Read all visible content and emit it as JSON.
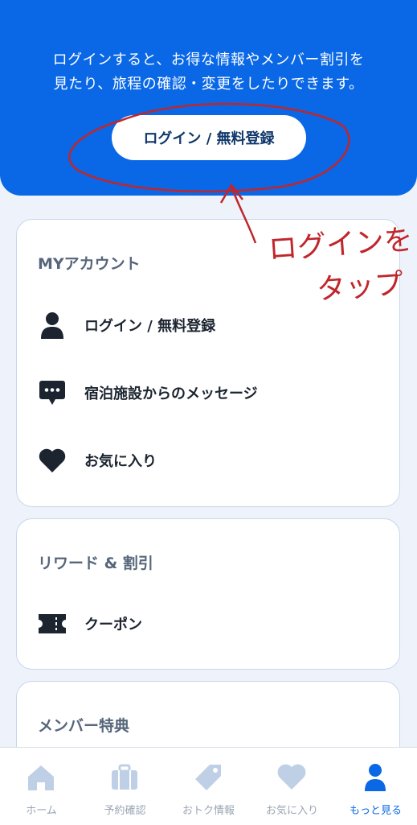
{
  "hero": {
    "message_line1": "ログインすると、お得な情報やメンバー割引を",
    "message_line2": "見たり、旅程の確認・変更をしたりできます。",
    "login_button": "ログイン / 無料登録"
  },
  "sections": {
    "my_account": {
      "title": "MYアカウント",
      "items": [
        {
          "label": "ログイン / 無料登録",
          "icon": "person-icon"
        },
        {
          "label": "宿泊施設からのメッセージ",
          "icon": "message-icon"
        },
        {
          "label": "お気に入り",
          "icon": "heart-icon"
        }
      ]
    },
    "rewards": {
      "title": "リワード & 割引",
      "items": [
        {
          "label": "クーポン",
          "icon": "ticket-icon"
        }
      ]
    },
    "member": {
      "title": "メンバー特典"
    }
  },
  "annotation": {
    "text_line1": "ログインを",
    "text_line2": "タップ",
    "color": "#c0262b"
  },
  "bottom_nav": {
    "items": [
      {
        "label": "ホーム",
        "icon": "home-icon",
        "active": false
      },
      {
        "label": "予約確認",
        "icon": "suitcase-icon",
        "active": false
      },
      {
        "label": "おトク情報",
        "icon": "tag-icon",
        "active": false
      },
      {
        "label": "お気に入り",
        "icon": "heart-icon",
        "active": false
      },
      {
        "label": "もっと見る",
        "icon": "person-icon",
        "active": true
      }
    ]
  },
  "colors": {
    "primary": "#0a68e6",
    "background": "#eef3fb",
    "inactive_nav": "#9aa5b4",
    "dark_icon": "#1c2430"
  }
}
